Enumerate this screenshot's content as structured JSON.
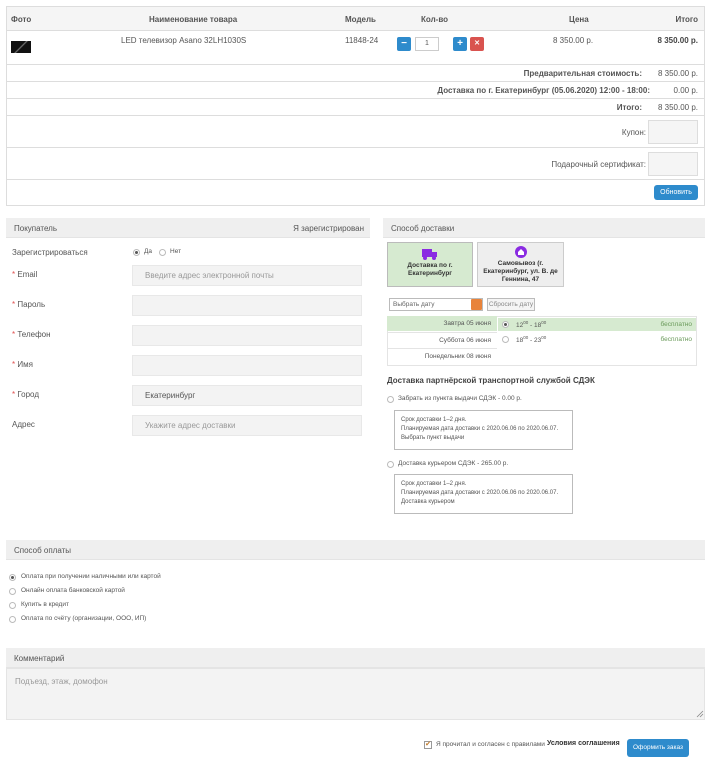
{
  "cart": {
    "headers": {
      "photo": "Фото",
      "name": "Наименование товара",
      "model": "Модель",
      "qty": "Кол-во",
      "price": "Цена",
      "total": "Итого"
    },
    "item": {
      "name": "LED телевизор Asano 32LH1030S",
      "model": "11848-24",
      "qty": "1",
      "price": "8 350.00 р.",
      "total": "8 350.00 р."
    },
    "qty_minus": "−",
    "qty_plus": "+",
    "qty_remove": "✕",
    "prelim_label": "Предварительная стоимость:",
    "prelim_value": "8 350.00 р.",
    "delivery_label": "Доставка по г. Екатеринбург (05.06.2020) 12:00 - 18:00:",
    "delivery_value": "0.00 р.",
    "total_label": "Итого:",
    "total_value": "8 350.00 р.",
    "coupon_label": "Купон:",
    "gift_label": "Подарочный сертификат:",
    "update_button": "Обновить"
  },
  "buyer": {
    "title": "Покупатель",
    "registered_link": "Я зарегистрирован",
    "register_label": "Зарегистрироваться",
    "yes": "Да",
    "no": "Нет",
    "fields": [
      {
        "label": "Email",
        "required": "*",
        "placeholder": "Введите адрес электронной почты"
      },
      {
        "label": "Пароль",
        "required": "*",
        "placeholder": ""
      },
      {
        "label": "Телефон",
        "required": "*",
        "placeholder": ""
      },
      {
        "label": "Имя",
        "required": "*",
        "placeholder": ""
      },
      {
        "label": "Город",
        "required": "*",
        "value": "Екатеринбург"
      },
      {
        "label": "Адрес",
        "required": "",
        "placeholder": "Укажите адрес доставки"
      }
    ]
  },
  "delivery": {
    "title": "Способ доставки",
    "tab_city": "Доставка по г. Екатеринбург",
    "tab_pickup": "Самовывоз (г. Екатеринбург, ул. В. де Геннина, 47",
    "date_placeholder": "Выбрать дату",
    "reset_date": "Сбросить дату",
    "days": [
      "Завтра 05 июня",
      "Суббота 06 июня",
      "Понедельник 08 июня"
    ],
    "slots": [
      {
        "from": "12",
        "from_sup": "00",
        "to": "18",
        "to_sup": "00",
        "price": "бесплатно"
      },
      {
        "from": "18",
        "from_sup": "00",
        "to": "23",
        "to_sup": "00",
        "price": "бесплатно"
      }
    ],
    "cdek_title": "Доставка партнёрской транспортной службой СДЭК",
    "cdek_pickup_label": "Забрать из пункта выдачи СДЭК - 0.00 р.",
    "cdek_pickup_lines": [
      "Срок доставки 1–2 дня.",
      "Планируемая дата доставки с 2020.06.06 по 2020.06.07.",
      "Выбрать пункт выдачи"
    ],
    "cdek_courier_label": "Доставка курьером СДЭК - 265.00 р.",
    "cdek_courier_lines": [
      "Срок доставки 1–2 дня.",
      "Планируемая дата доставки с 2020.06.06 по 2020.06.07.",
      "Доставка курьером"
    ]
  },
  "payment": {
    "title": "Способ оплаты",
    "options": [
      "Оплата при получении наличными или картой",
      "Онлайн оплата банковской картой",
      "Купить в кредит",
      "Оплата по счёту (организации, ООО, ИП)"
    ]
  },
  "comment": {
    "title": "Комментарий",
    "placeholder": "Подъезд, этаж, домофон"
  },
  "footer": {
    "agree_text": "Я прочитал и согласен с правилами",
    "agree_link": "Условия соглашения",
    "submit_button": "Оформить заказ"
  },
  "colors": {
    "accent": "#2e8bcc",
    "danger": "#d9534f",
    "green": "#d6ead0",
    "purple": "#8a2be2"
  }
}
